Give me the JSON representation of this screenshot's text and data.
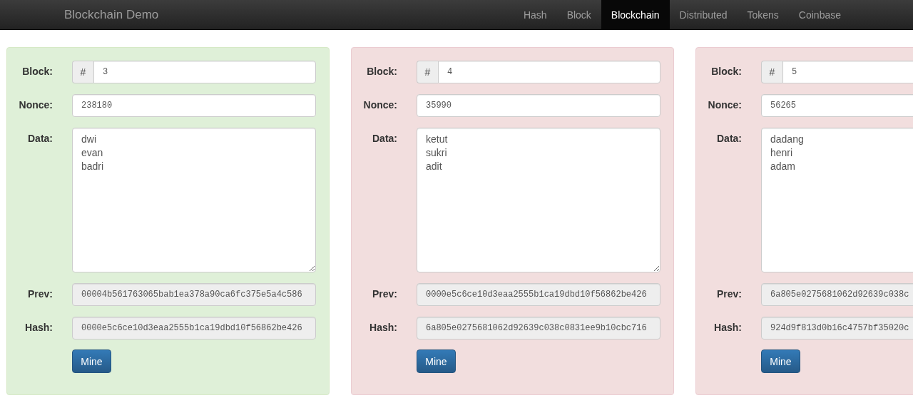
{
  "navbar": {
    "brand": "Blockchain Demo",
    "items": [
      {
        "label": "Hash",
        "selected": false
      },
      {
        "label": "Block",
        "selected": false
      },
      {
        "label": "Blockchain",
        "selected": true
      },
      {
        "label": "Distributed",
        "selected": false
      },
      {
        "label": "Tokens",
        "selected": false
      },
      {
        "label": "Coinbase",
        "selected": false
      }
    ]
  },
  "blocks": [
    {
      "valid": true,
      "block_label": "Block:",
      "block_prefix": "#",
      "block": "3",
      "nonce_label": "Nonce:",
      "nonce": "238180",
      "data_label": "Data:",
      "data": [
        "dwi",
        "evan",
        "badri"
      ],
      "prev_label": "Prev:",
      "prev": "00004b561763065bab1ea378a90ca6fc375e5a4c586",
      "hash_label": "Hash:",
      "hash": "0000e5c6ce10d3eaa2555b1ca19dbd10f56862be426",
      "button": "Mine"
    },
    {
      "valid": false,
      "block_label": "Block:",
      "block_prefix": "#",
      "block": "4",
      "nonce_label": "Nonce:",
      "nonce": "35990",
      "data_label": "Data:",
      "data": [
        "ketut",
        "sukri",
        "adit"
      ],
      "prev_label": "Prev:",
      "prev": "0000e5c6ce10d3eaa2555b1ca19dbd10f56862be426",
      "hash_label": "Hash:",
      "hash": "6a805e0275681062d92639c038c0831ee9b10cbc716",
      "button": "Mine"
    },
    {
      "valid": false,
      "block_label": "Block:",
      "block_prefix": "#",
      "block": "5",
      "nonce_label": "Nonce:",
      "nonce": "56265",
      "data_label": "Data:",
      "data": [
        "dadang",
        "henri",
        "adam"
      ],
      "prev_label": "Prev:",
      "prev": "6a805e0275681062d92639c038c",
      "hash_label": "Hash:",
      "hash": "924d9f813d0b16c4757bf35020c",
      "button": "Mine"
    }
  ]
}
